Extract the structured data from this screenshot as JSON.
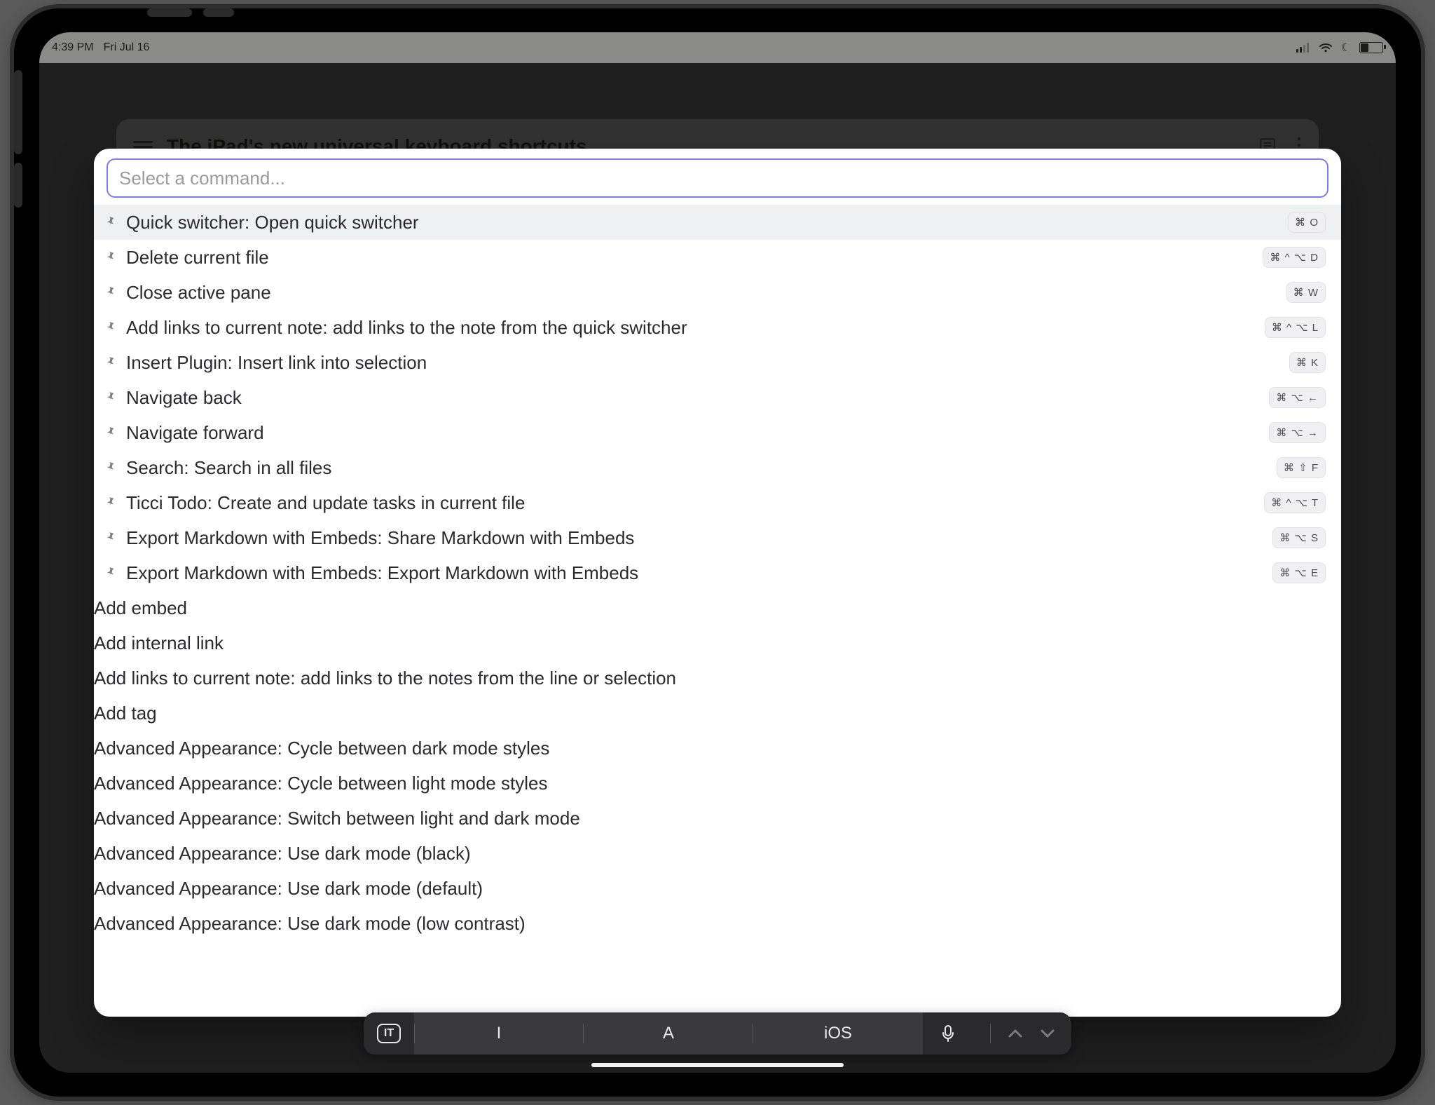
{
  "status": {
    "time": "4:39 PM",
    "date": "Fri Jul 16"
  },
  "note": {
    "title": "The iPad's new universal keyboard shortcuts"
  },
  "palette": {
    "placeholder": "Select a command...",
    "items": [
      {
        "pinned": true,
        "label": "Quick switcher: Open quick switcher",
        "shortcut": "⌘ O",
        "selected": true
      },
      {
        "pinned": true,
        "label": "Delete current file",
        "shortcut": "⌘ ^ ⌥ D"
      },
      {
        "pinned": true,
        "label": "Close active pane",
        "shortcut": "⌘ W"
      },
      {
        "pinned": true,
        "label": "Add links to current note: add links to the note from the quick switcher",
        "shortcut": "⌘ ^ ⌥ L"
      },
      {
        "pinned": true,
        "label": "Insert Plugin: Insert link into selection",
        "shortcut": "⌘ K"
      },
      {
        "pinned": true,
        "label": "Navigate back",
        "shortcut": "⌘ ⌥ ←"
      },
      {
        "pinned": true,
        "label": "Navigate forward",
        "shortcut": "⌘ ⌥ →"
      },
      {
        "pinned": true,
        "label": "Search: Search in all files",
        "shortcut": "⌘ ⇧ F"
      },
      {
        "pinned": true,
        "label": "Ticci Todo: Create and update tasks in current file",
        "shortcut": "⌘ ^ ⌥ T"
      },
      {
        "pinned": true,
        "label": "Export Markdown with Embeds: Share Markdown with Embeds",
        "shortcut": "⌘ ⌥ S"
      },
      {
        "pinned": true,
        "label": "Export Markdown with Embeds: Export Markdown with Embeds",
        "shortcut": "⌘ ⌥ E"
      },
      {
        "pinned": false,
        "label": "Add embed"
      },
      {
        "pinned": false,
        "label": "Add internal link"
      },
      {
        "pinned": false,
        "label": "Add links to current note: add links to the notes from the line or selection"
      },
      {
        "pinned": false,
        "label": "Add tag"
      },
      {
        "pinned": false,
        "label": "Advanced Appearance: Cycle between dark mode styles"
      },
      {
        "pinned": false,
        "label": "Advanced Appearance: Cycle between light mode styles"
      },
      {
        "pinned": false,
        "label": "Advanced Appearance: Switch between light and dark mode"
      },
      {
        "pinned": false,
        "label": "Advanced Appearance: Use dark mode (black)"
      },
      {
        "pinned": false,
        "label": "Advanced Appearance: Use dark mode (default)"
      },
      {
        "pinned": false,
        "label": "Advanced Appearance: Use dark mode (low contrast)"
      }
    ]
  },
  "keyboard_bar": {
    "language": "IT",
    "suggestions": [
      "I",
      "A",
      "iOS"
    ]
  }
}
